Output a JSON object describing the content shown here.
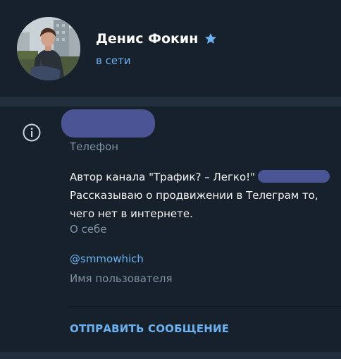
{
  "profile": {
    "name": "Денис Фокин",
    "status": "в сети",
    "verified_icon": "star-icon",
    "accent_color": "#6ab2f2"
  },
  "info": {
    "icon": "info-icon",
    "phone_label": "Телефон",
    "bio_line1": "Автор канала \"Трафик? – Легко!\"",
    "bio_line2": "Рассказываю о продвижении в Телеграм то,",
    "bio_line3": "чего нет в интернете.",
    "bio_label": "О себе",
    "username": "@smmowhich",
    "username_label": "Имя пользователя"
  },
  "actions": {
    "send_message": "ОТПРАВИТЬ СООБЩЕНИЕ"
  }
}
